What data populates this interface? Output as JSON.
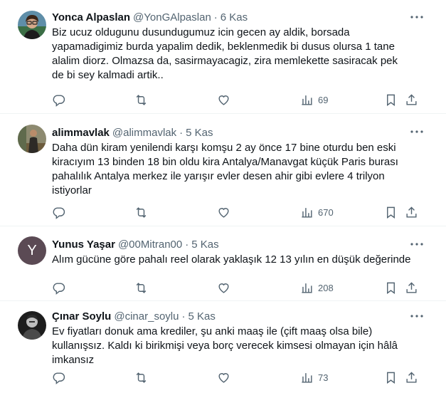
{
  "tweets": [
    {
      "name": "Yonca Alpaslan",
      "handle": "@YonGAlpaslan",
      "separator": "·",
      "time": "6 Kas",
      "text": "Biz ucuz oldugunu dusundugumuz icin gecen ay aldik, borsada yapamadigimiz burda yapalim dedik, beklenmedik bi dusus olursa 1 tane alalim diorz. Olmazsa da, sasirmayacagiz, zira memlekette sasiracak pek de bi sey kalmadi artik..",
      "views": "69",
      "avatar": "photo-woman-glasses"
    },
    {
      "name": "alimmavlak",
      "handle": "@alimmavlak",
      "separator": "·",
      "time": "5 Kas",
      "text": "Daha dün kiram yenilendi karşı komşu 2 ay önce 17 bine oturdu ben eski kiracıyım 13 binden 18 bin oldu kira Antalya/Manavgat küçük Paris burası pahalılık Antalya merkez ile yarışır evler desen ahir gibi evlere 4 trilyon istiyorlar",
      "views": "670",
      "avatar": "photo-man-outdoor"
    },
    {
      "name": "Yunus Yaşar",
      "handle": "@00Mitran00",
      "separator": "·",
      "time": "5 Kas",
      "text": "Alım gücüne göre pahalı reel olarak yaklaşık 12 13 yılın en düşük değerinde",
      "views": "208",
      "avatar_letter": "Y",
      "avatar_color": "#5b4a54"
    },
    {
      "name": "Çınar Soylu",
      "handle": "@cinar_soylu",
      "separator": "·",
      "time": "5 Kas",
      "text": "Ev fiyatları donuk ama krediler, şu anki maaş ile (çift maaş olsa bile) kullanışsız. Kaldı ki birikmişi veya borç verecek kimsesi olmayan için hâlâ imkansız",
      "views": "73",
      "avatar": "photo-man-bw"
    }
  ],
  "icons": {
    "more": "more-icon",
    "reply": "reply-icon",
    "retweet": "retweet-icon",
    "like": "like-icon",
    "views": "views-icon",
    "bookmark": "bookmark-icon",
    "share": "share-icon"
  },
  "colors": {
    "text": "#0f1419",
    "muted": "#536471",
    "divider": "#eff3f4"
  }
}
